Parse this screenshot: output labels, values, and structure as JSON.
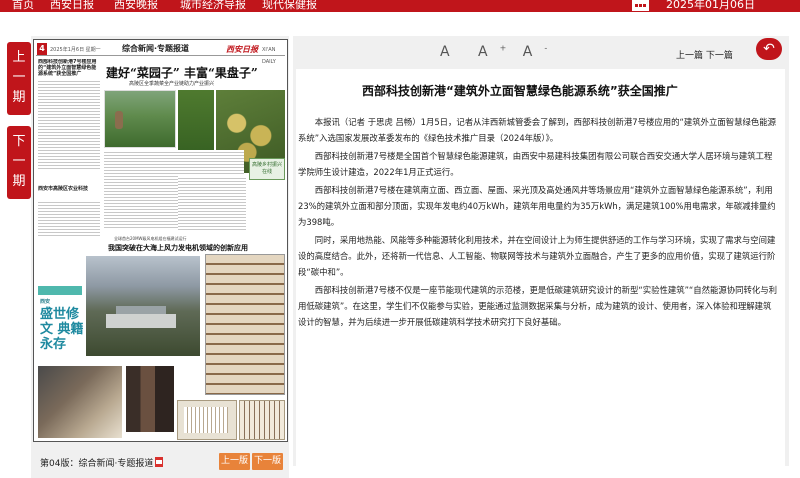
{
  "nav": {
    "items": [
      "首页",
      "西安日报",
      "西安晚报",
      "城市经济导报",
      "现代保健报"
    ],
    "date": "2025年01月06日"
  },
  "side": {
    "prev_issue": [
      "上",
      "一",
      "期"
    ],
    "next_issue": [
      "下",
      "一",
      "期"
    ]
  },
  "paper": {
    "page_number": "4",
    "header_date": "2025年1月6日 星期一",
    "section": "综合新闻·专题报道",
    "masthead": "西安日报",
    "masthead_sub": "XI'AN DAILY",
    "main_headline": "建好“菜园子” 丰富“果盘子”",
    "main_subheadline": "高陵区全季蔬菜全产业链助力产业振兴",
    "left_col_headline": "西部科技创新港7号楼应用的“建筑外立面智慧绿色能源系统”获全国推广",
    "left_col_headline2": "西安市高陵区农业科技",
    "stamp_text": "高陵乡村振兴在线",
    "second_prehead": "全球首台20MW级风电机组在福建试运行",
    "second_headline": "我国突破在大海上风力发电机领域的创新应用",
    "culture_brand": "西安",
    "culture_title": "盛世修文 典籍永存"
  },
  "footer": {
    "page_label": "第04版：综合新闻·专题报道",
    "prev_page": "上一版",
    "next_page": "下一版"
  },
  "reader": {
    "font_small": "A",
    "font_plus": "A",
    "font_plus_sign": "+",
    "font_minus": "A",
    "font_minus_sign": "-",
    "prev_article": "上一篇",
    "next_article": "下一篇",
    "back": "↶"
  },
  "article": {
    "title": "西部科技创新港“建筑外立面智慧绿色能源系统”获全国推广",
    "paragraphs": [
      "本报讯（记者 于思虎 吕畅）1月5日，记者从沣西新城管委会了解到，西部科技创新港7号楼应用的“建筑外立面智慧绿色能源系统”入选国家发展改革委发布的《绿色技术推广目录（2024年版）》。",
      "西部科技创新港7号楼是全国首个智慧绿色能源建筑，由西安中易建科技集团有限公司联合西安交通大学人居环境与建筑工程学院师生设计建造，2022年1月正式运行。",
      "西部科技创新港7号楼在建筑南立面、西立面、屋面、采光顶及高处通风井等场景应用“建筑外立面智慧绿色能源系统”，利用23%的建筑外立面和部分顶面，实现年发电约40万kWh，建筑年用电量约为35万kWh，满足建筑100%用电需求，年碳减排量约为398吨。",
      "同时，采用地热能、风能等多种能源转化利用技术，并在空间设计上为师生提供舒适的工作与学习环境，实现了需求与空间建设的高度结合。此外，还将新一代信息、人工智能、物联网等技术与建筑外立面融合，产生了更多的应用价值，实现了建筑运行阶段“碳中和”。",
      "西部科技创新港7号楼不仅是一座节能现代建筑的示范楼，更是低碳建筑研究设计的新型“实验性建筑”“自然能源协同转化与利用低碳建筑”。在这里，学生们不仅能参与实验，更能通过监测数据采集与分析，成为建筑的设计、使用者，深入体验和理解建筑设计的智慧，并为后续进一步开展低碳建筑科学技术研究打下良好基础。"
    ]
  }
}
